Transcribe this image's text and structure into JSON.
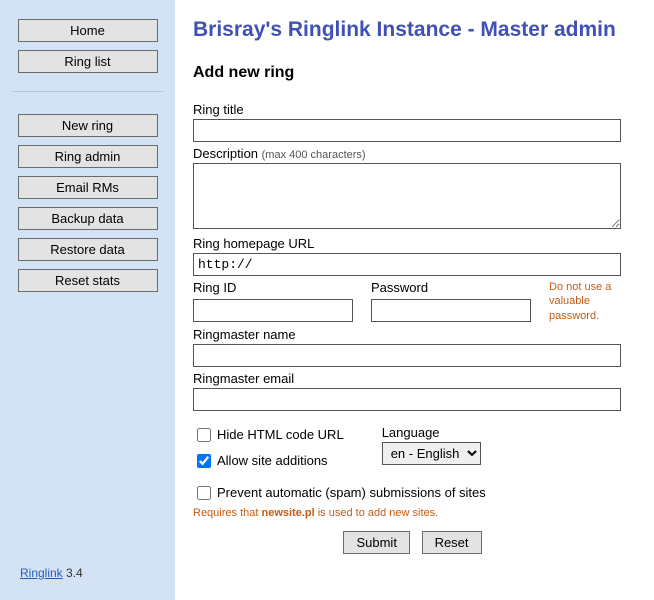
{
  "sidebar": {
    "group1": [
      {
        "label": "Home"
      },
      {
        "label": "Ring list"
      }
    ],
    "group2": [
      {
        "label": "New ring"
      },
      {
        "label": "Ring admin"
      },
      {
        "label": "Email RMs"
      },
      {
        "label": "Backup data"
      },
      {
        "label": "Restore data"
      },
      {
        "label": "Reset stats"
      }
    ],
    "footer_link": "Ringlink",
    "footer_version": " 3.4"
  },
  "header": {
    "title": "Brisray's Ringlink Instance  -  Master admin"
  },
  "section_title": "Add new ring",
  "form": {
    "ring_title_label": "Ring title",
    "ring_title_value": "",
    "description_label": "Description ",
    "description_hint": "(max 400 characters)",
    "description_value": "",
    "homepage_label": "Ring homepage URL",
    "homepage_value": "http://",
    "ring_id_label": "Ring ID",
    "ring_id_value": "",
    "password_label": "Password",
    "password_value": "",
    "password_warning": "Do not use a valuable password.",
    "ringmaster_name_label": "Ringmaster name",
    "ringmaster_name_value": "",
    "ringmaster_email_label": "Ringmaster email",
    "ringmaster_email_value": "",
    "hide_html_label": "Hide HTML code URL",
    "allow_additions_label": "Allow site additions",
    "prevent_spam_label": "Prevent automatic (spam) submissions of sites",
    "prevent_spam_note_prefix": "Requires that ",
    "prevent_spam_note_bold": "newsite.pl",
    "prevent_spam_note_suffix": " is used to add new sites.",
    "language_label": "Language",
    "language_selected": "en - English",
    "submit_label": "Submit",
    "reset_label": "Reset"
  }
}
